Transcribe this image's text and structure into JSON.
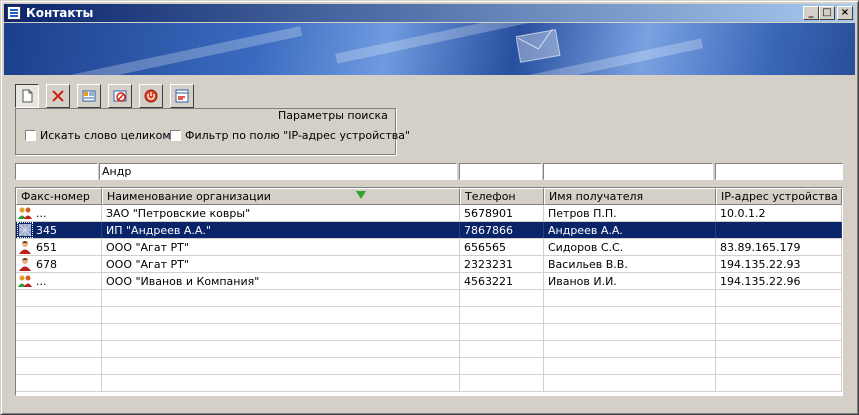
{
  "window": {
    "title": "Контакты",
    "controls": {
      "minimize": "_",
      "maximize": "□",
      "close": "×"
    }
  },
  "toolbar": {
    "buttons": [
      {
        "name": "new",
        "icon": "new-document-icon"
      },
      {
        "name": "delete",
        "icon": "delete-x-icon"
      },
      {
        "name": "properties",
        "icon": "card-properties-icon"
      },
      {
        "name": "edit",
        "icon": "edit-card-icon"
      },
      {
        "name": "stop",
        "icon": "power-icon"
      },
      {
        "name": "export",
        "icon": "export-icon"
      }
    ]
  },
  "search_params": {
    "title": "Параметры поиска",
    "whole_word": {
      "label": "Искать слово целиком",
      "checked": false
    },
    "ip_filter": {
      "label": "Фильтр по полю \"IP-адрес устройства\"",
      "checked": false
    }
  },
  "filters": {
    "fax": "",
    "org": "Андр",
    "phone": "",
    "recipient": "",
    "ip": ""
  },
  "table": {
    "columns": [
      "Факс-номер",
      "Наименование организации",
      "Телефон",
      "Имя получателя",
      "IP-адрес устройства"
    ],
    "sort_column": "Наименование организации",
    "rows": [
      {
        "icon": "group-contact-icon",
        "fax": "...",
        "org": "ЗАО \"Петровские ковры\"",
        "phone": "5678901",
        "recipient": "Петров П.П.",
        "ip": "10.0.1.2",
        "selected": false
      },
      {
        "icon": "fax-contact-icon",
        "fax": "345",
        "org": "ИП \"Андреев А.А.\"",
        "phone": "7867866",
        "recipient": "Андреев А.А.",
        "ip": "",
        "selected": true
      },
      {
        "icon": "person-contact-icon",
        "fax": "651",
        "org": "ООО \"Агат РТ\"",
        "phone": "656565",
        "recipient": "Сидоров С.С.",
        "ip": "83.89.165.179",
        "selected": false
      },
      {
        "icon": "person-contact-icon",
        "fax": "678",
        "org": "ООО \"Агат РТ\"",
        "phone": "2323231",
        "recipient": "Васильев В.В.",
        "ip": "194.135.22.93",
        "selected": false
      },
      {
        "icon": "group-contact-icon",
        "fax": "...",
        "org": "ООО \"Иванов и Компания\"",
        "phone": "4563221",
        "recipient": "Иванов И.И.",
        "ip": "194.135.22.96",
        "selected": false
      }
    ]
  },
  "colors": {
    "selection": "#0a246a",
    "title_gradient_start": "#0a246a",
    "title_gradient_end": "#a6caf0",
    "sort_arrow": "#2ea42e"
  }
}
